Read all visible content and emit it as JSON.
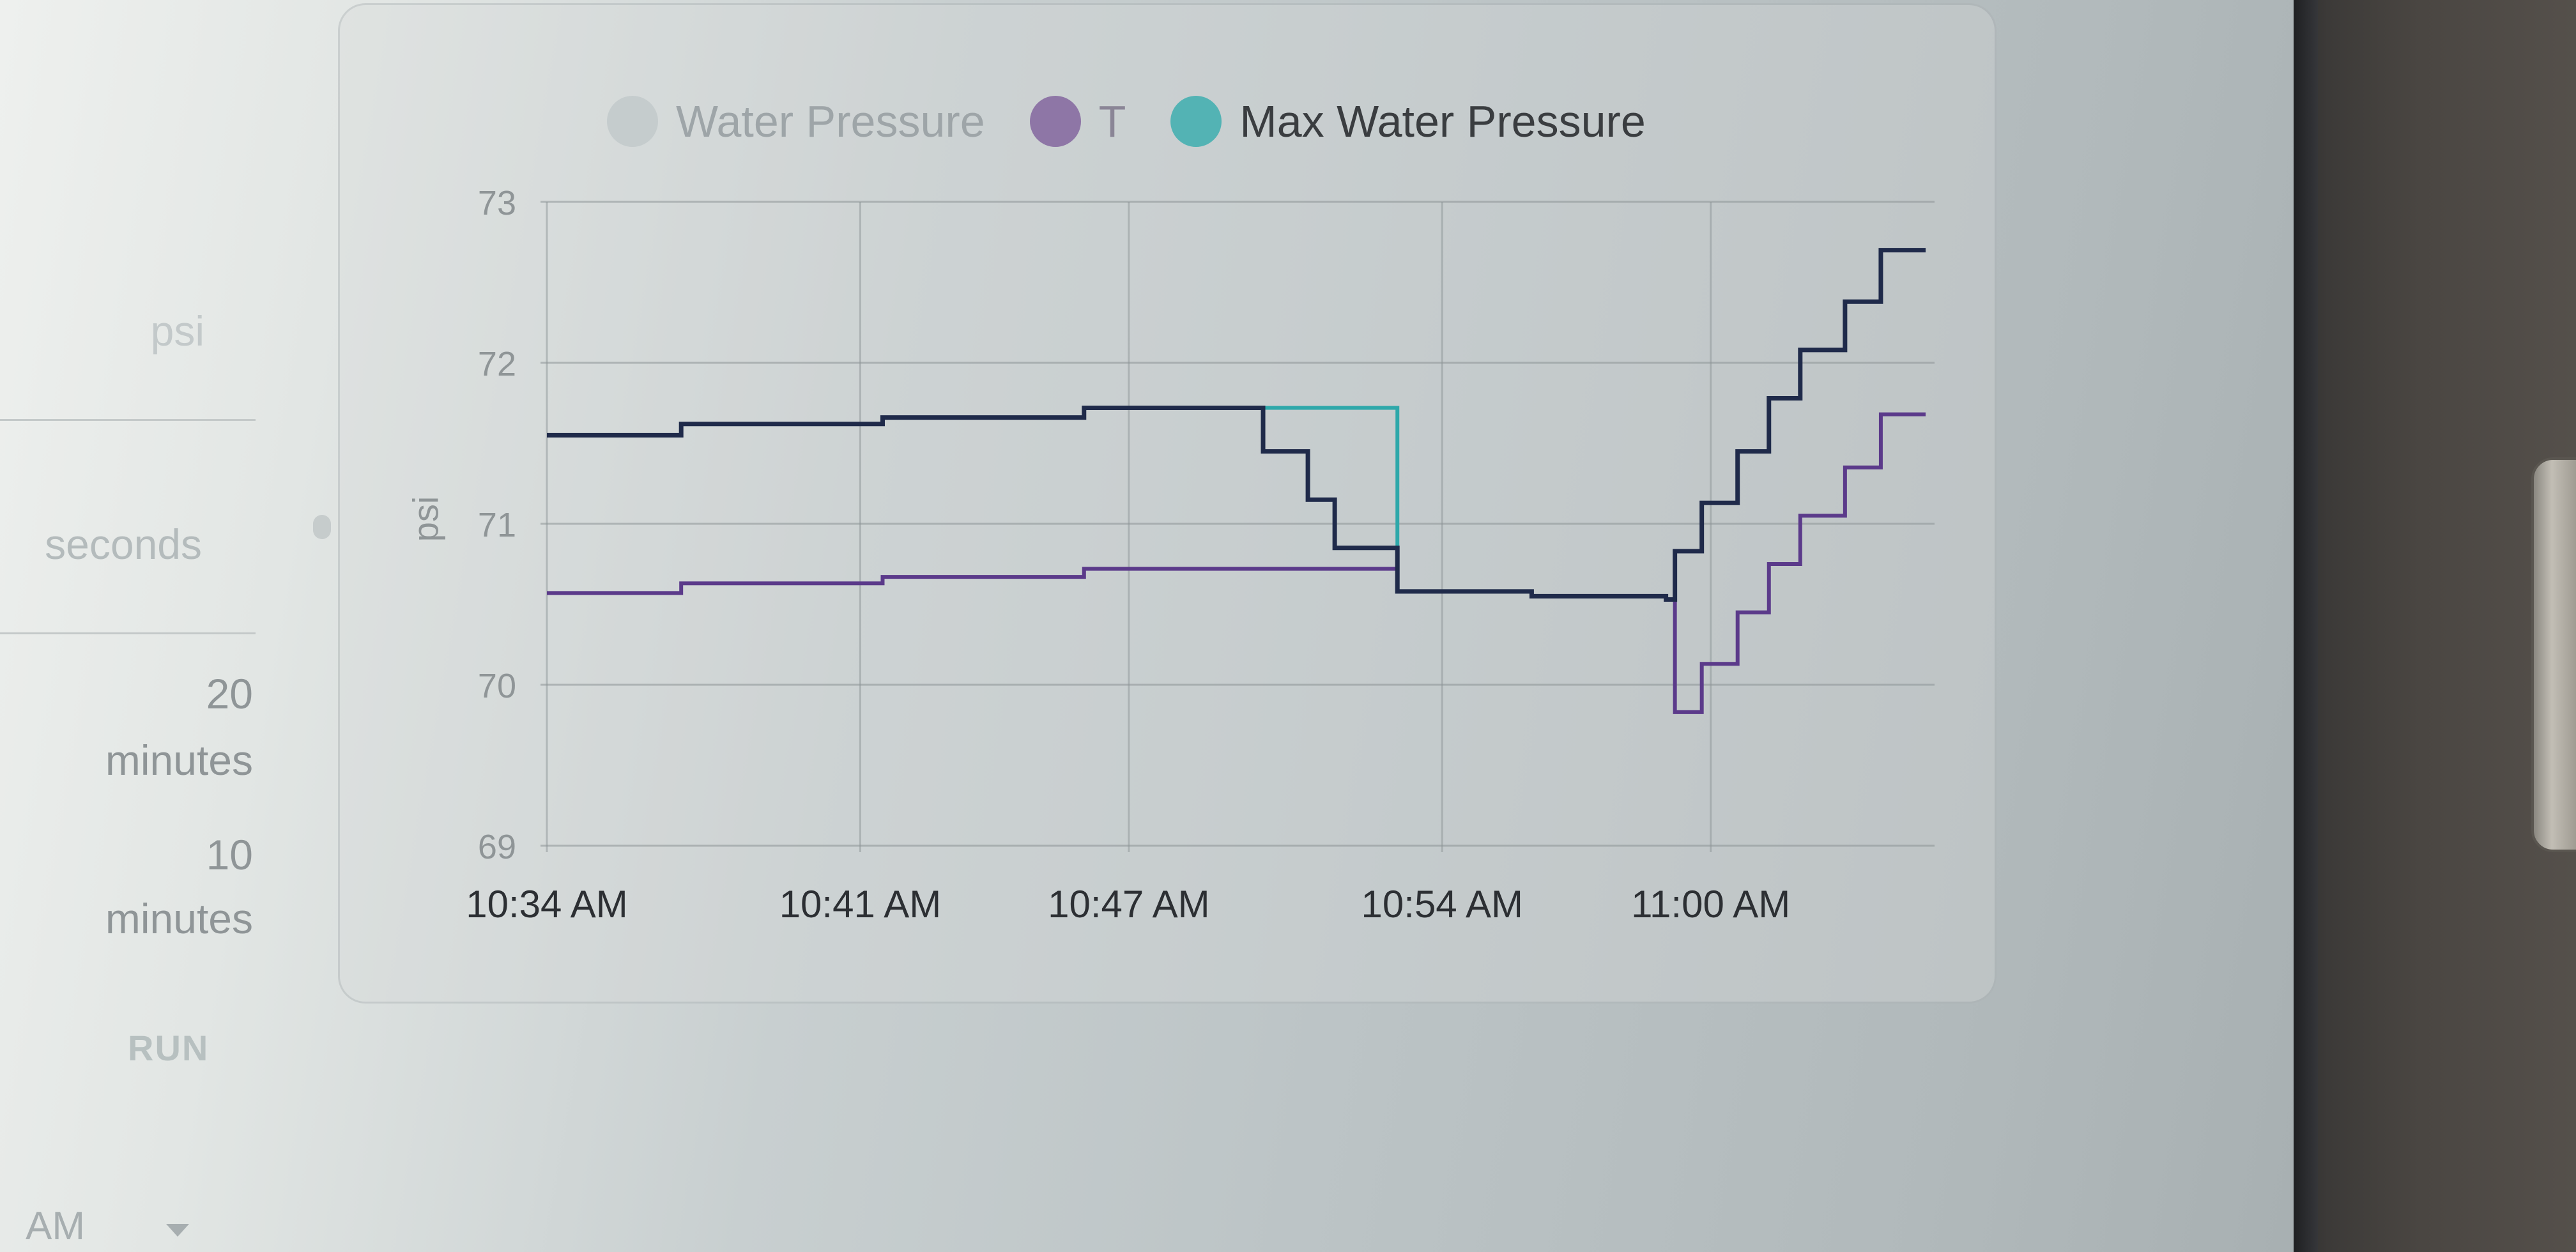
{
  "left_panel": {
    "unit_label": "psi",
    "seconds_label": "seconds",
    "option_1_value": "20",
    "option_1_unit": "minutes",
    "option_2_value": "10",
    "option_2_unit": "minutes",
    "run_label": "RUN",
    "ampm_label": "AM"
  },
  "colors": {
    "water_pressure": "#c5cccd",
    "t": "#6a4f86",
    "max_water_pressure": "#2ea8aa",
    "line_dark": "#1f2a4a",
    "line_purple": "#5b3a8a",
    "grid": "#8c9396"
  },
  "chart_data": {
    "type": "line",
    "title": "",
    "xlabel": "",
    "ylabel": "psi",
    "ylim": [
      69,
      73
    ],
    "yticks": [
      "73",
      "72",
      "71",
      "70",
      "69"
    ],
    "xticks": [
      "10:34 AM",
      "10:41 AM",
      "10:47 AM",
      "10:54 AM",
      "11:00 AM"
    ],
    "xlim": [
      "10:34",
      "11:05"
    ],
    "grid": true,
    "legend_position": "top",
    "step": true,
    "series": [
      {
        "name": "Water Pressure",
        "color": "#c5cccd",
        "points": []
      },
      {
        "name": "T",
        "color": "#5b3a8a",
        "points": [
          [
            "10:34",
            70.57
          ],
          [
            "10:37",
            70.63
          ],
          [
            "10:41.5",
            70.67
          ],
          [
            "10:46",
            70.72
          ],
          [
            "10:53",
            70.58
          ],
          [
            "10:56",
            70.55
          ],
          [
            "10:59",
            70.53
          ],
          [
            "10:59.2",
            69.83
          ],
          [
            "10:59.8",
            70.13
          ],
          [
            "11:00.6",
            70.45
          ],
          [
            "11:01.3",
            70.75
          ],
          [
            "11:02",
            71.05
          ],
          [
            "11:03",
            71.35
          ],
          [
            "11:03.8",
            71.68
          ],
          [
            "11:04.8",
            71.68
          ]
        ]
      },
      {
        "name": "Max Water Pressure",
        "color": "#2ea8aa",
        "points": [
          [
            "10:34",
            71.55
          ],
          [
            "10:37",
            71.62
          ],
          [
            "10:41.5",
            71.66
          ],
          [
            "10:46",
            71.72
          ],
          [
            "10:53",
            70.58
          ],
          [
            "10:56",
            70.55
          ],
          [
            "10:59",
            70.53
          ],
          [
            "10:59.2",
            70.83
          ],
          [
            "10:59.8",
            71.13
          ],
          [
            "11:00.6",
            71.45
          ],
          [
            "11:01.3",
            71.78
          ],
          [
            "11:02",
            72.08
          ],
          [
            "11:03",
            72.38
          ],
          [
            "11:03.8",
            72.7
          ],
          [
            "11:04.8",
            72.7
          ]
        ]
      },
      {
        "name": "",
        "color": "#1f2a4a",
        "points": [
          [
            "10:34",
            71.55
          ],
          [
            "10:37",
            71.62
          ],
          [
            "10:41.5",
            71.66
          ],
          [
            "10:46",
            71.72
          ],
          [
            "10:50",
            71.45
          ],
          [
            "10:51",
            71.15
          ],
          [
            "10:51.6",
            70.85
          ],
          [
            "10:53",
            70.58
          ],
          [
            "10:56",
            70.55
          ],
          [
            "10:59",
            70.53
          ],
          [
            "10:59.2",
            70.83
          ],
          [
            "10:59.8",
            71.13
          ],
          [
            "11:00.6",
            71.45
          ],
          [
            "11:01.3",
            71.78
          ],
          [
            "11:02",
            72.08
          ],
          [
            "11:03",
            72.38
          ],
          [
            "11:03.8",
            72.7
          ],
          [
            "11:04.8",
            72.7
          ]
        ]
      }
    ]
  }
}
